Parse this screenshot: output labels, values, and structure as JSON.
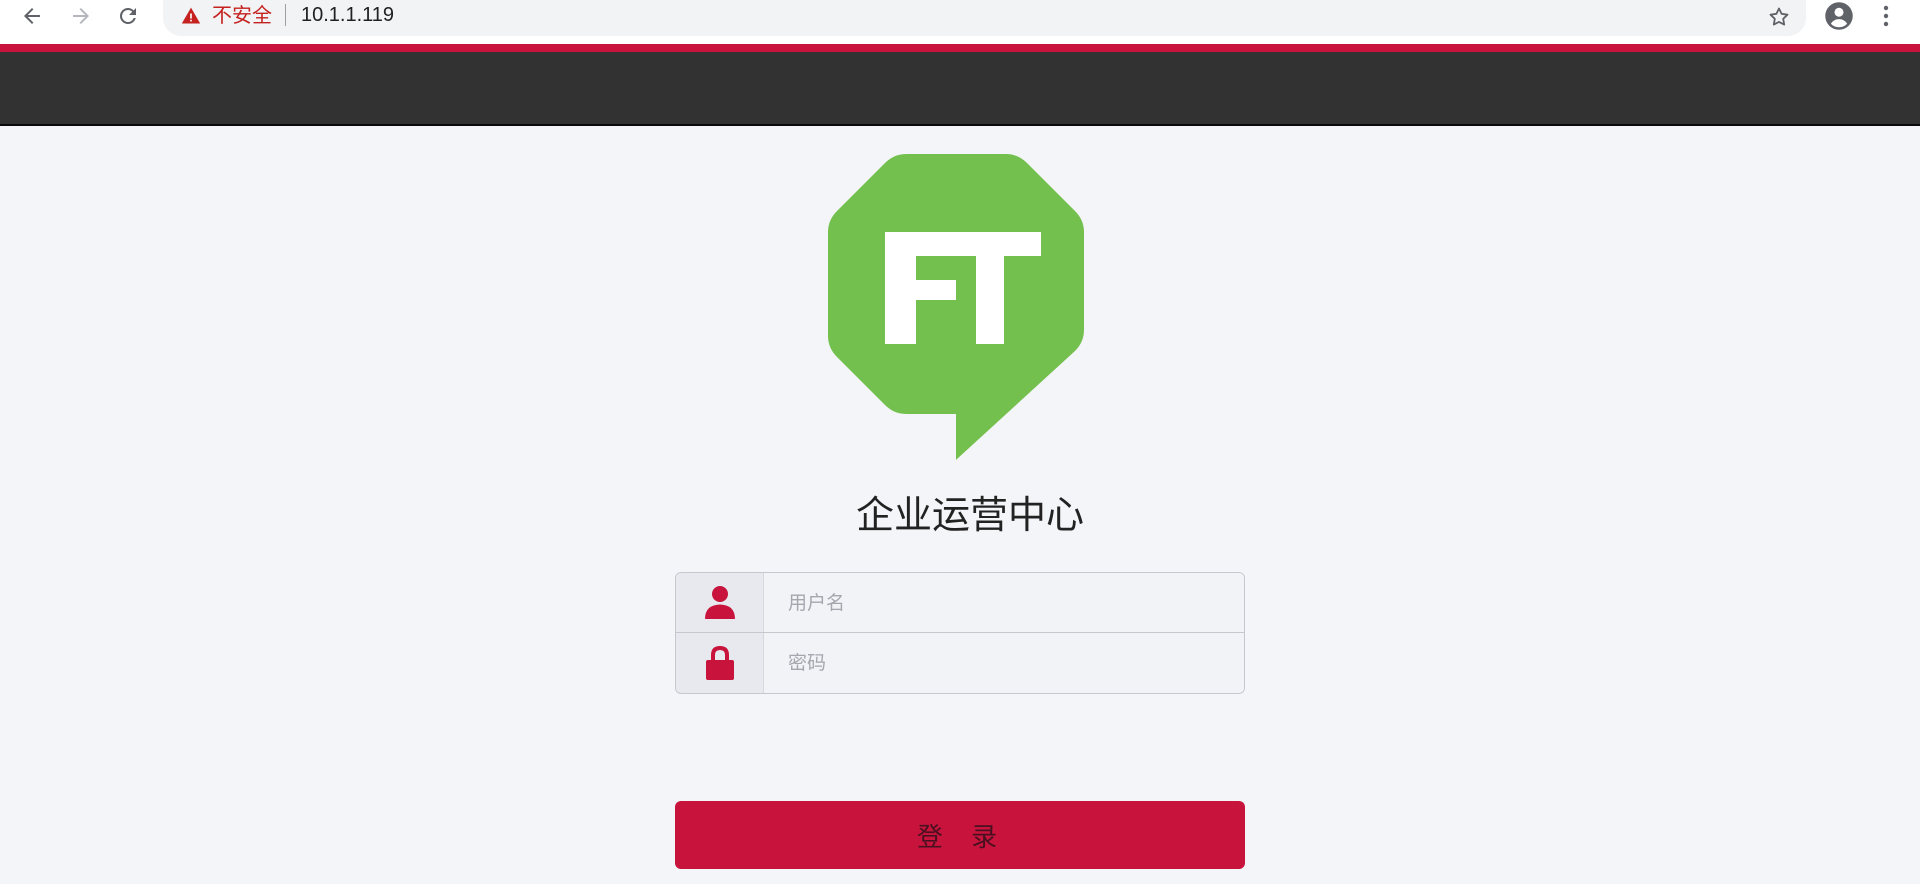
{
  "browser": {
    "security_label": "不安全",
    "url": "10.1.1.119",
    "icons": [
      "back-icon",
      "forward-icon",
      "reload-icon",
      "warning-icon",
      "star-icon",
      "account-icon",
      "more-icon"
    ]
  },
  "header": {
    "accent_color": "#c8143c",
    "background_color": "#323232"
  },
  "logo": {
    "text": "FT",
    "color": "#74c04e"
  },
  "app": {
    "title": "企业运营中心"
  },
  "login_form": {
    "username_placeholder": "用户名",
    "username_value": "",
    "password_placeholder": "密码",
    "password_value": "",
    "submit_label": "登 录",
    "icon_color": "#c8143c",
    "icons": [
      "user-icon",
      "lock-icon"
    ]
  }
}
